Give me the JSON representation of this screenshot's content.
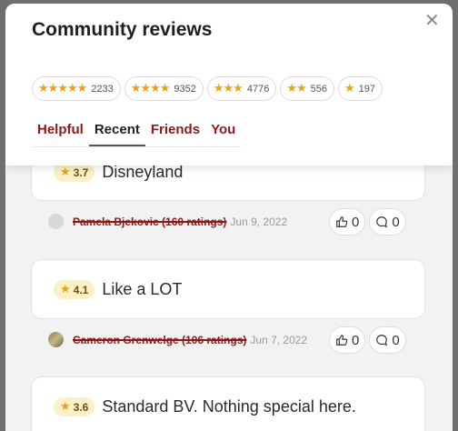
{
  "modal": {
    "title": "Community reviews",
    "close_icon": "close-icon"
  },
  "rating_filters": [
    {
      "stars": "★★★★★",
      "count": "2233"
    },
    {
      "stars": "★★★★",
      "count": "9352"
    },
    {
      "stars": "★★★",
      "count": "4776"
    },
    {
      "stars": "★★",
      "count": "556"
    },
    {
      "stars": "★",
      "count": "197"
    }
  ],
  "tabs": [
    {
      "label": "Helpful"
    },
    {
      "label": "Recent",
      "active": true
    },
    {
      "label": "Friends"
    },
    {
      "label": "You"
    }
  ],
  "reviews": [
    {
      "rating": "3.7",
      "title": "Disneyland",
      "reviewer": "Pamela Bjekovic (160 ratings)",
      "date": "Jun 9, 2022",
      "likes": "0",
      "comments": "0"
    },
    {
      "rating": "4.1",
      "title": "Like a LOT",
      "reviewer": "Cameron Grenwelge (106 ratings)",
      "date": "Jun 7, 2022",
      "likes": "0",
      "comments": "0"
    },
    {
      "rating": "3.6",
      "title": "Standard BV. Nothing special here."
    }
  ],
  "colors": {
    "accent": "#8b1a1a",
    "star": "#e8a317",
    "rating_pill": "#fbf1c8"
  }
}
